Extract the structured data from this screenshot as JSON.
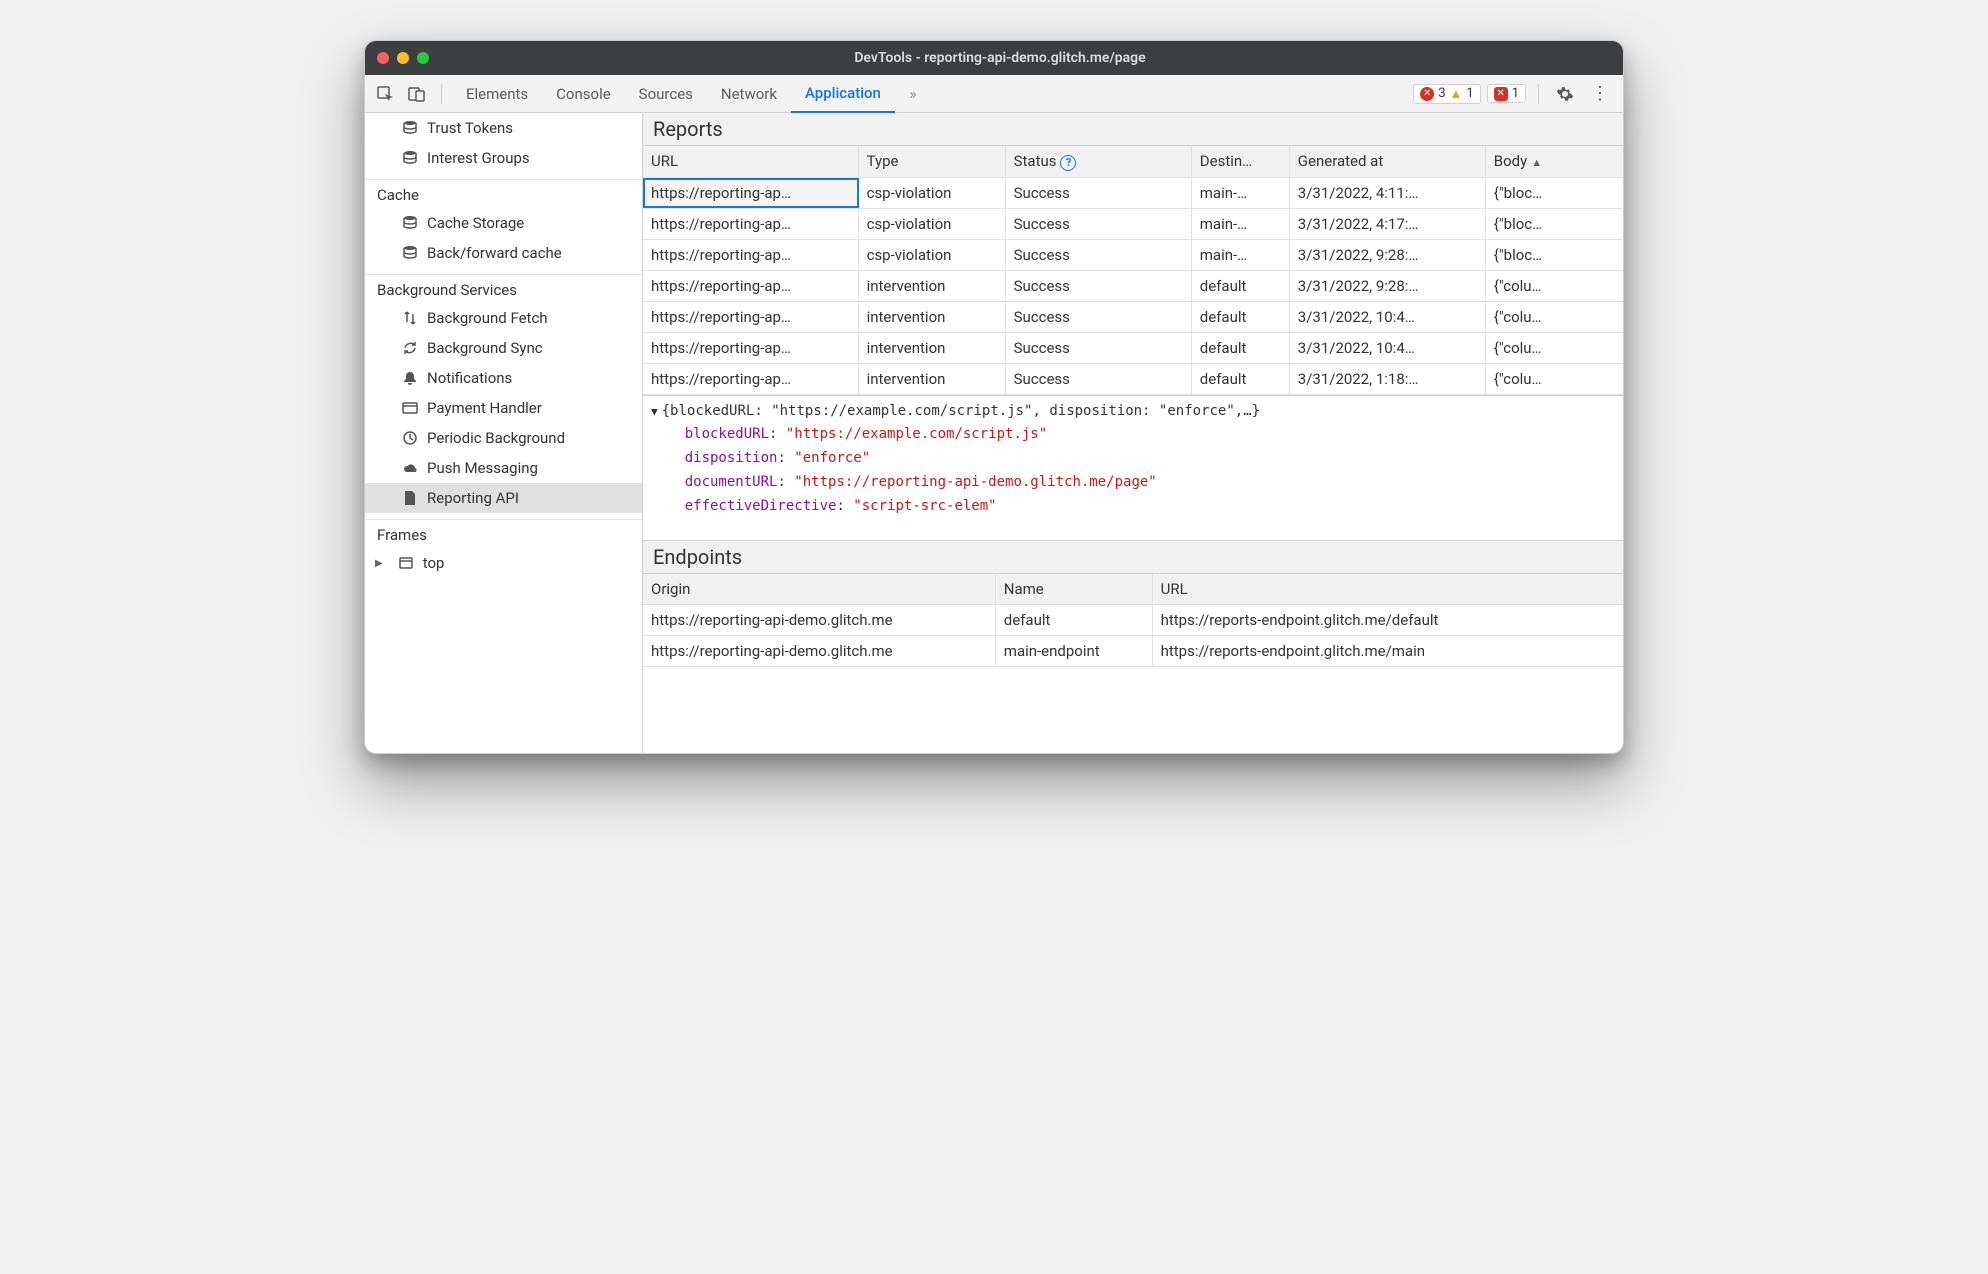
{
  "titlebar": {
    "title": "DevTools - reporting-api-demo.glitch.me/page"
  },
  "toolbar": {
    "tabs": [
      "Elements",
      "Console",
      "Sources",
      "Network",
      "Application"
    ],
    "active_tab": "Application",
    "error_count": "3",
    "warn_count": "1",
    "issue_count": "1"
  },
  "sidebar": {
    "top_items": [
      {
        "icon": "db",
        "label": "Trust Tokens"
      },
      {
        "icon": "db",
        "label": "Interest Groups"
      }
    ],
    "groups": [
      {
        "label": "Cache",
        "items": [
          {
            "icon": "db",
            "label": "Cache Storage"
          },
          {
            "icon": "db",
            "label": "Back/forward cache"
          }
        ]
      },
      {
        "label": "Background Services",
        "items": [
          {
            "icon": "transfer",
            "label": "Background Fetch"
          },
          {
            "icon": "sync",
            "label": "Background Sync"
          },
          {
            "icon": "bell",
            "label": "Notifications"
          },
          {
            "icon": "card",
            "label": "Payment Handler"
          },
          {
            "icon": "clock",
            "label": "Periodic Background"
          },
          {
            "icon": "cloud",
            "label": "Push Messaging"
          },
          {
            "icon": "file",
            "label": "Reporting API",
            "selected": true
          }
        ]
      },
      {
        "label": "Frames",
        "items": [
          {
            "icon": "frame",
            "label": "top",
            "expandable": true
          }
        ]
      }
    ]
  },
  "reports": {
    "title": "Reports",
    "columns": [
      "URL",
      "Type",
      "Status",
      "Destin…",
      "Generated at",
      "Body"
    ],
    "rows": [
      {
        "url": "https://reporting-ap…",
        "type": "csp-violation",
        "status": "Success",
        "dest": "main-…",
        "time": "3/31/2022, 4:11:…",
        "body": "{\"bloc…",
        "selected": true
      },
      {
        "url": "https://reporting-ap…",
        "type": "csp-violation",
        "status": "Success",
        "dest": "main-…",
        "time": "3/31/2022, 4:17:…",
        "body": "{\"bloc…"
      },
      {
        "url": "https://reporting-ap…",
        "type": "csp-violation",
        "status": "Success",
        "dest": "main-…",
        "time": "3/31/2022, 9:28:…",
        "body": "{\"bloc…"
      },
      {
        "url": "https://reporting-ap…",
        "type": "intervention",
        "status": "Success",
        "dest": "default",
        "time": "3/31/2022, 9:28:…",
        "body": "{\"colu…"
      },
      {
        "url": "https://reporting-ap…",
        "type": "intervention",
        "status": "Success",
        "dest": "default",
        "time": "3/31/2022, 10:4…",
        "body": "{\"colu…"
      },
      {
        "url": "https://reporting-ap…",
        "type": "intervention",
        "status": "Success",
        "dest": "default",
        "time": "3/31/2022, 10:4…",
        "body": "{\"colu…"
      },
      {
        "url": "https://reporting-ap…",
        "type": "intervention",
        "status": "Success",
        "dest": "default",
        "time": "3/31/2022, 1:18:…",
        "body": "{\"colu…"
      }
    ]
  },
  "detail": {
    "summary": "{blockedURL: \"https://example.com/script.js\", disposition: \"enforce\",…}",
    "props": [
      {
        "key": "blockedURL",
        "val": "\"https://example.com/script.js\""
      },
      {
        "key": "disposition",
        "val": "\"enforce\""
      },
      {
        "key": "documentURL",
        "val": "\"https://reporting-api-demo.glitch.me/page\""
      },
      {
        "key": "effectiveDirective",
        "val": "\"script-src-elem\""
      }
    ]
  },
  "endpoints": {
    "title": "Endpoints",
    "columns": [
      "Origin",
      "Name",
      "URL"
    ],
    "rows": [
      {
        "origin": "https://reporting-api-demo.glitch.me",
        "name": "default",
        "url": "https://reports-endpoint.glitch.me/default"
      },
      {
        "origin": "https://reporting-api-demo.glitch.me",
        "name": "main-endpoint",
        "url": "https://reports-endpoint.glitch.me/main"
      }
    ]
  }
}
